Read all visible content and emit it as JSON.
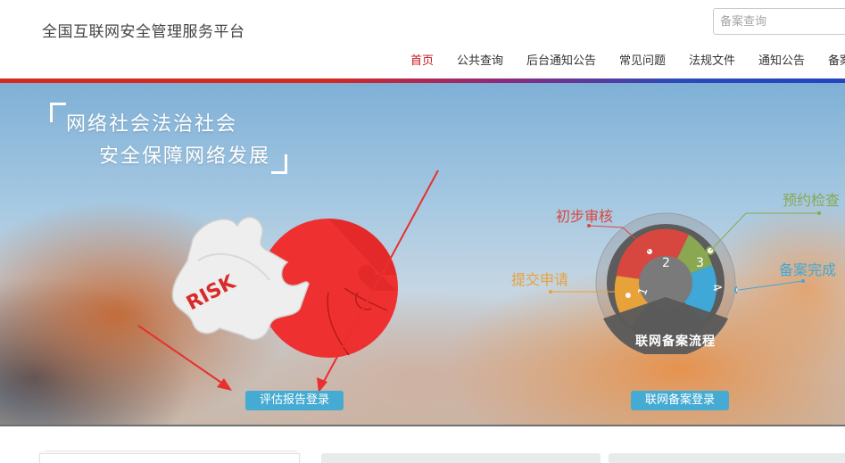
{
  "header": {
    "site_title": "全国互联网安全管理服务平台",
    "search_placeholder": "备案查询"
  },
  "nav": {
    "items": [
      {
        "label": "首页",
        "active": true
      },
      {
        "label": "公共查询",
        "active": false
      },
      {
        "label": "后台通知公告",
        "active": false
      },
      {
        "label": "常见问题",
        "active": false
      },
      {
        "label": "法规文件",
        "active": false
      },
      {
        "label": "通知公告",
        "active": false
      },
      {
        "label": "备案",
        "active": false
      }
    ]
  },
  "banner": {
    "slogan_line1": "网络社会法治社会",
    "slogan_line2": "安全保障网络发展",
    "puzzle_word": "RISK",
    "assess_button": "评估报告登录",
    "filing_button": "联网备案登录",
    "process": {
      "caption": "联网备案流程",
      "steps": [
        {
          "number": "1",
          "label": "提交申请",
          "color": "#e8a23a"
        },
        {
          "number": "2",
          "label": "初步审核",
          "color": "#d8473f"
        },
        {
          "number": "3",
          "label": "预约检查",
          "color": "#8aa851"
        },
        {
          "number": "4",
          "label": "备案完成",
          "color": "#3fa8d7"
        }
      ]
    }
  },
  "colors": {
    "brand_red": "#c4161c",
    "puzzle_red": "#ef3030",
    "button_blue": "#46abd2"
  }
}
